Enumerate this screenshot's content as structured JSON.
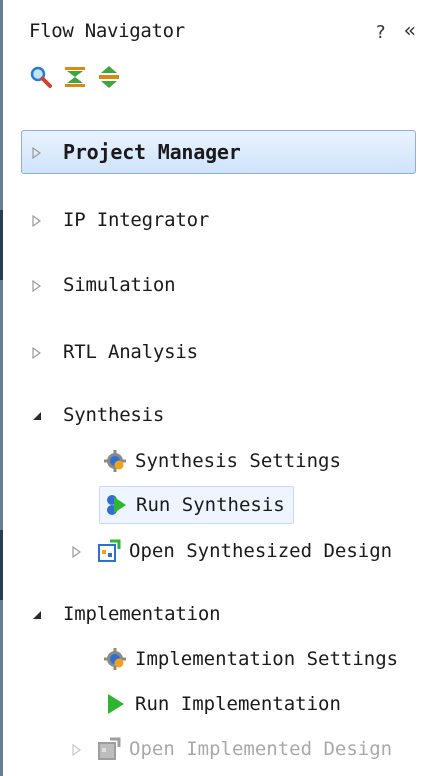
{
  "panel": {
    "title": "Flow Navigator",
    "help": "?",
    "collapse": "«",
    "toolbar": [
      {
        "icon": "search-icon"
      },
      {
        "icon": "collapse-all-icon"
      },
      {
        "icon": "expand-all-icon"
      }
    ]
  },
  "sections": [
    {
      "label": "Project Manager",
      "expanded": false,
      "selected": true
    },
    {
      "label": "IP Integrator",
      "expanded": false
    },
    {
      "label": "Simulation",
      "expanded": false
    },
    {
      "label": "RTL Analysis",
      "expanded": false
    },
    {
      "label": "Synthesis",
      "expanded": true,
      "items": [
        {
          "label": "Synthesis Settings",
          "icon": "gear-icon"
        },
        {
          "label": "Run Synthesis",
          "icon": "run-synthesis-icon"
        },
        {
          "label": "Open Synthesized Design",
          "icon": "open-design-icon",
          "expandable": true
        }
      ]
    },
    {
      "label": "Implementation",
      "expanded": true,
      "items": [
        {
          "label": "Implementation Settings",
          "icon": "gear-icon"
        },
        {
          "label": "Run Implementation",
          "icon": "play-icon"
        },
        {
          "label": "Open Implemented Design",
          "icon": "open-design-icon",
          "expandable": true,
          "disabled": true
        }
      ]
    }
  ],
  "colors": {
    "selected_bg": "#cfe3fb",
    "selected_border": "#8ab0e0",
    "play_green": "#2fb52f",
    "disabled_text": "#a9a9a9"
  }
}
